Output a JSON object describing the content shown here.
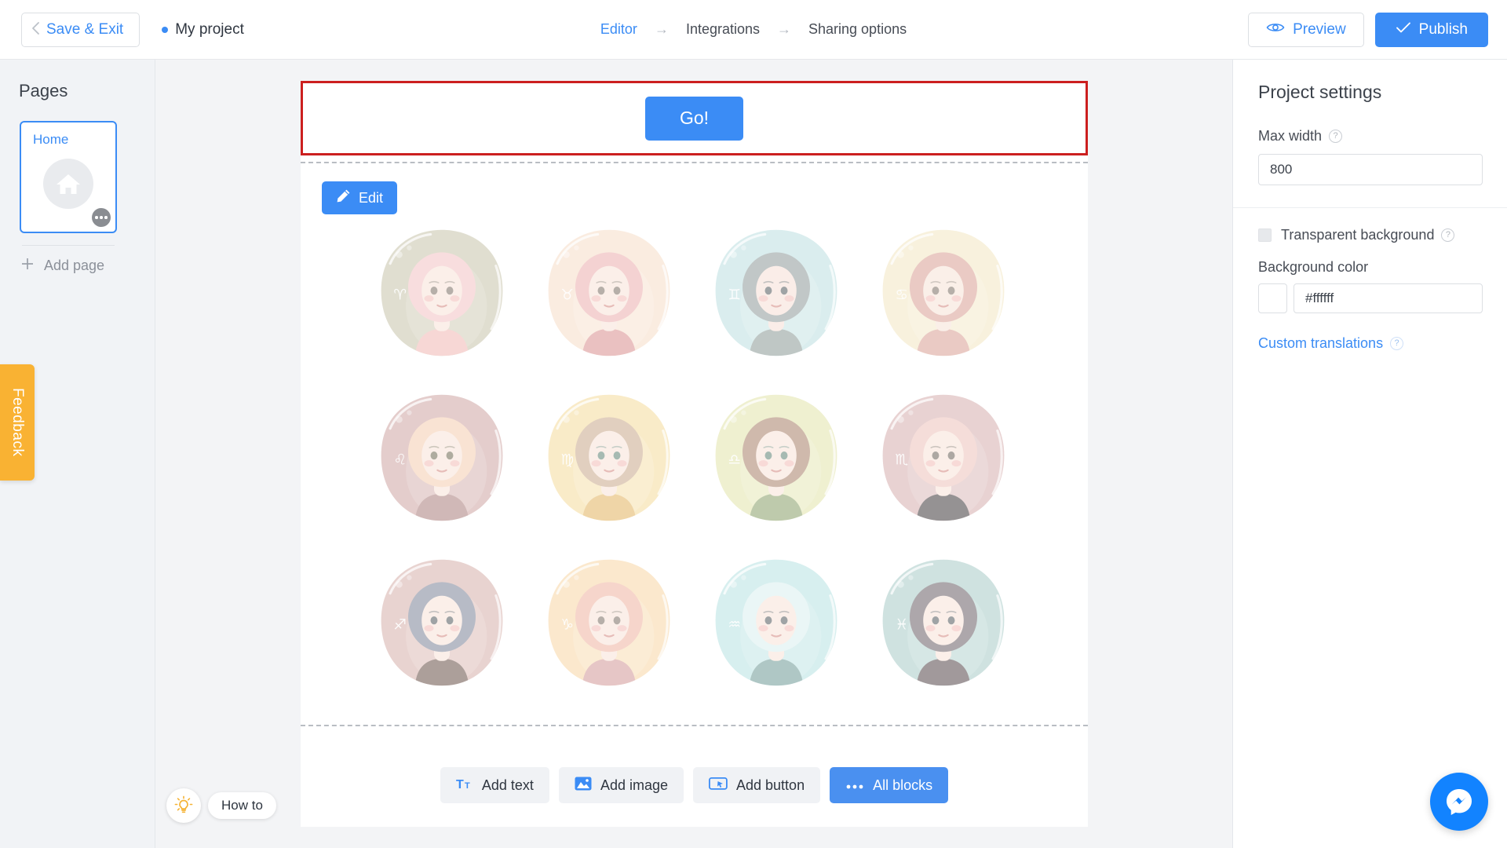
{
  "topbar": {
    "save_exit_label": "Save & Exit",
    "project_name": "My project",
    "breadcrumb": [
      {
        "label": "Editor",
        "active": true
      },
      {
        "label": "Integrations",
        "active": false
      },
      {
        "label": "Sharing options",
        "active": false
      }
    ],
    "breadcrumb_separator": "→",
    "preview_label": "Preview",
    "publish_label": "Publish",
    "accent_color": "#3b8cf5"
  },
  "sidebar": {
    "title": "Pages",
    "pages": [
      {
        "label": "Home",
        "icon": "home-icon",
        "selected": true
      }
    ],
    "add_page_label": "Add page",
    "feedback_label": "Feedback",
    "feedback_color": "#f9b233"
  },
  "canvas": {
    "selected_block_outline_color": "#cc1f1f",
    "go_button_label": "Go!",
    "edit_button_label": "Edit",
    "zodiac": [
      {
        "name": "Aries",
        "glyph": "♈",
        "bg": "#c8c4ab",
        "hair": "#f3c3c4",
        "skin": "#f8e3d8",
        "dress": "#f2b7b3",
        "eye": "#7c6f63"
      },
      {
        "name": "Taurus",
        "glyph": "♉",
        "bg": "#f7ddc8",
        "hair": "#ecaeae",
        "skin": "#f8e3d8",
        "dress": "#d9908f",
        "eye": "#7c6f63"
      },
      {
        "name": "Gemini",
        "glyph": "♊",
        "bg": "#bde0e1",
        "hair": "#8f9a9a",
        "skin": "#f6e0d6",
        "dress": "#8c9a96",
        "eye": "#51585c"
      },
      {
        "name": "Cancer",
        "glyph": "♋",
        "bg": "#f3e7c2",
        "hair": "#d99f95",
        "skin": "#f7e2d7",
        "dress": "#d99f95",
        "eye": "#7c6f63"
      },
      {
        "name": "Leo",
        "glyph": "♌",
        "bg": "#cfa6a4",
        "hair": "#f5cdb0",
        "skin": "#f8e3d8",
        "dress": "#ab7f7d",
        "eye": "#6f6a52"
      },
      {
        "name": "Virgo",
        "glyph": "♍",
        "bg": "#f5dc9c",
        "hair": "#c9a98c",
        "skin": "#f8e3d8",
        "dress": "#e2b461",
        "eye": "#5e8275"
      },
      {
        "name": "Libra",
        "glyph": "♎",
        "bg": "#e2e4aa",
        "hair": "#a9806a",
        "skin": "#f8e3d8",
        "dress": "#8aa06a",
        "eye": "#5e8275"
      },
      {
        "name": "Scorpio",
        "glyph": "♏",
        "bg": "#d6aeae",
        "hair": "#edc3bb",
        "skin": "#f8e3d8",
        "dress": "#3f3a3c",
        "eye": "#6b6258"
      },
      {
        "name": "Sagittarius",
        "glyph": "♐",
        "bg": "#d7b0ab",
        "hair": "#7d8599",
        "skin": "#f8e3d8",
        "dress": "#6a5249",
        "eye": "#51585c"
      },
      {
        "name": "Capricorn",
        "glyph": "♑",
        "bg": "#f8d7a6",
        "hair": "#f0b4a1",
        "skin": "#f8e3d8",
        "dress": "#d29898",
        "eye": "#7c6f63"
      },
      {
        "name": "Aquarius",
        "glyph": "♒",
        "bg": "#b8e2e2",
        "hair": "#d9f0ef",
        "skin": "#f8e3d8",
        "dress": "#6f9b97",
        "eye": "#51585c"
      },
      {
        "name": "Pisces",
        "glyph": "♓",
        "bg": "#a8ccc8",
        "hair": "#6b6168",
        "skin": "#f8e3d8",
        "dress": "#56464a",
        "eye": "#51585c"
      }
    ],
    "toolbar": [
      {
        "label": "Add text",
        "icon": "text-icon",
        "primary": false
      },
      {
        "label": "Add image",
        "icon": "image-icon",
        "primary": false
      },
      {
        "label": "Add button",
        "icon": "button-icon",
        "primary": false
      },
      {
        "label": "All blocks",
        "icon": "ellipsis-icon",
        "primary": true
      }
    ]
  },
  "right_panel": {
    "title": "Project settings",
    "max_width_label": "Max width",
    "max_width_value": "800",
    "transparent_bg_label": "Transparent background",
    "transparent_bg_checked": false,
    "background_color_label": "Background color",
    "background_color_value": "#ffffff",
    "custom_translations_label": "Custom translations",
    "help_glyph": "?"
  },
  "overlays": {
    "howto_label": "How to",
    "messenger_icon": "messenger-icon",
    "messenger_color": "#1283ff"
  }
}
